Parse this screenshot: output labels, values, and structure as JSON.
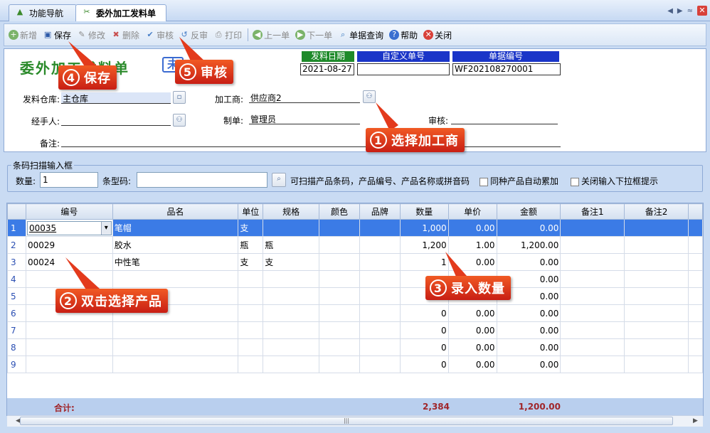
{
  "tabs": [
    {
      "label": "功能导航",
      "icon": "navigation-icon"
    },
    {
      "label": "委外加工发料单",
      "icon": "tools-icon"
    }
  ],
  "toolbar": {
    "new": "新增",
    "save": "保存",
    "edit": "修改",
    "delete": "删除",
    "audit": "审核",
    "unaudit": "反审",
    "print": "打印",
    "prev": "上一单",
    "next": "下一单",
    "query": "单据查询",
    "help": "帮助",
    "close": "关闭"
  },
  "form": {
    "title": "委外加工发料单",
    "status": "未",
    "date_label": "发料日期",
    "date_value": "2021-08-27",
    "custom_no_label": "自定义单号",
    "custom_no_value": "",
    "doc_no_label": "单据编号",
    "doc_no_value": "WF202108270001",
    "warehouse_label": "发料仓库:",
    "warehouse_value": "主仓库",
    "processor_label": "加工商:",
    "processor_value": "供应商2",
    "handler_label": "经手人:",
    "handler_value": "",
    "maker_label": "制单:",
    "maker_value": "管理员",
    "auditor_label": "审核:",
    "auditor_value": "",
    "remark_label": "备注:",
    "remark_value": ""
  },
  "scan": {
    "legend": "条码扫描输入框",
    "qty_label": "数量:",
    "qty_value": "1",
    "barcode_label": "条型码:",
    "barcode_value": "",
    "hint": "可扫描产品条码，产品编号、产品名称或拼音码",
    "auto_add": "同种产品自动累加",
    "close_dropdown": "关闭输入下拉框提示"
  },
  "grid": {
    "columns": [
      "",
      "编号",
      "品名",
      "单位",
      "规格",
      "颜色",
      "品牌",
      "数量",
      "单价",
      "金额",
      "备注1",
      "备注2",
      ""
    ],
    "rows": [
      {
        "n": "1",
        "code": "00035",
        "name": "笔帽",
        "unit": "支",
        "spec": "",
        "color": "",
        "brand": "",
        "qty": "1,000",
        "price": "0.00",
        "amount": "0.00",
        "r1": "",
        "r2": ""
      },
      {
        "n": "2",
        "code": "00029",
        "name": "胶水",
        "unit": "瓶",
        "spec": "瓶",
        "color": "",
        "brand": "",
        "qty": "1,200",
        "price": "1.00",
        "amount": "1,200.00",
        "r1": "",
        "r2": ""
      },
      {
        "n": "3",
        "code": "00024",
        "name": "中性笔",
        "unit": "支",
        "spec": "支",
        "color": "",
        "brand": "",
        "qty": "1",
        "price": "0.00",
        "amount": "0.00",
        "r1": "",
        "r2": ""
      },
      {
        "n": "4",
        "code": "",
        "name": "",
        "unit": "",
        "spec": "",
        "color": "",
        "brand": "",
        "qty": "",
        "price": "",
        "amount": "0.00",
        "r1": "",
        "r2": ""
      },
      {
        "n": "5",
        "code": "",
        "name": "",
        "unit": "",
        "spec": "",
        "color": "",
        "brand": "",
        "qty": "",
        "price": "",
        "amount": "0.00",
        "r1": "",
        "r2": ""
      },
      {
        "n": "6",
        "code": "",
        "name": "",
        "unit": "",
        "spec": "",
        "color": "",
        "brand": "",
        "qty": "0",
        "price": "0.00",
        "amount": "0.00",
        "r1": "",
        "r2": ""
      },
      {
        "n": "7",
        "code": "",
        "name": "",
        "unit": "",
        "spec": "",
        "color": "",
        "brand": "",
        "qty": "0",
        "price": "0.00",
        "amount": "0.00",
        "r1": "",
        "r2": ""
      },
      {
        "n": "8",
        "code": "",
        "name": "",
        "unit": "",
        "spec": "",
        "color": "",
        "brand": "",
        "qty": "0",
        "price": "0.00",
        "amount": "0.00",
        "r1": "",
        "r2": ""
      },
      {
        "n": "9",
        "code": "",
        "name": "",
        "unit": "",
        "spec": "",
        "color": "",
        "brand": "",
        "qty": "0",
        "price": "0.00",
        "amount": "0.00",
        "r1": "",
        "r2": ""
      }
    ],
    "total_label": "合计:",
    "total_qty": "2,384",
    "total_amount": "1,200.00"
  },
  "callouts": [
    {
      "num": "1",
      "text": "选择加工商"
    },
    {
      "num": "2",
      "text": "双击选择产品"
    },
    {
      "num": "3",
      "text": "录入数量"
    },
    {
      "num": "4",
      "text": "保存"
    },
    {
      "num": "5",
      "text": "审核"
    }
  ],
  "colors": {
    "accent": "#3b7be6",
    "title_green": "#2a8a2a",
    "callout_red": "#e03a1c",
    "total_red": "#a0262a"
  }
}
